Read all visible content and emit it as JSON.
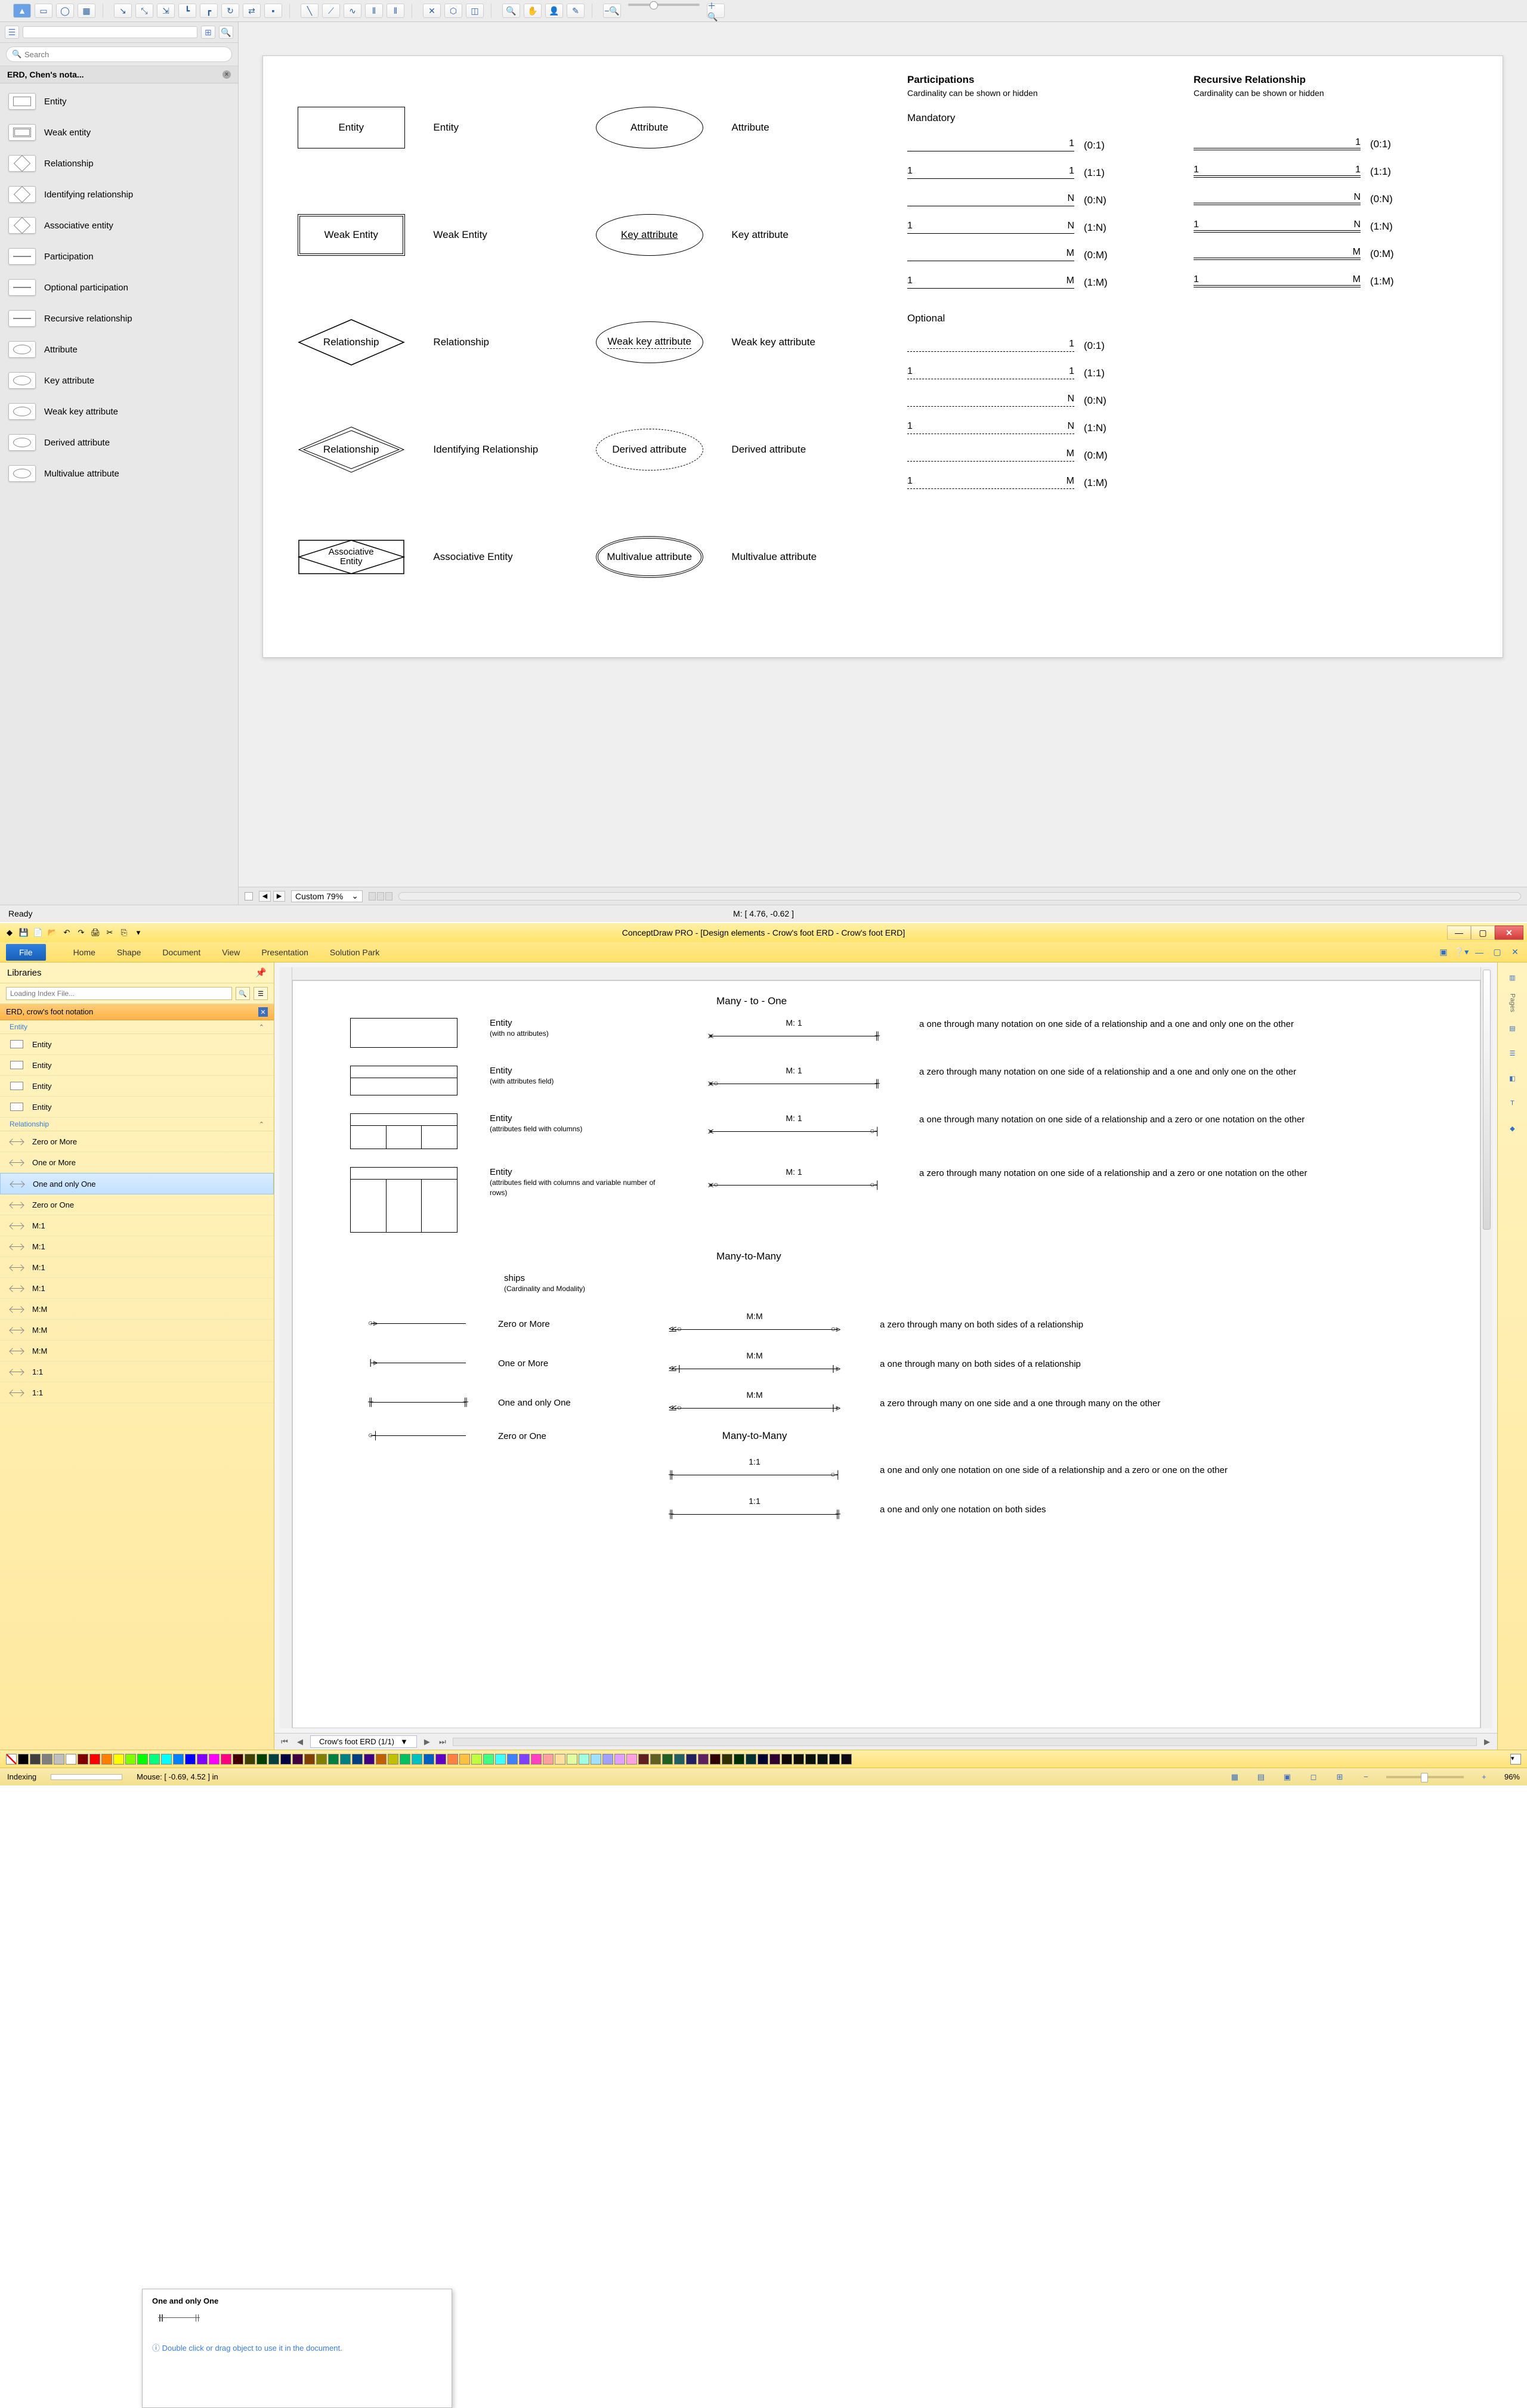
{
  "mac": {
    "search_placeholder": "Search",
    "library": {
      "title": "ERD, Chen's nota...",
      "items": [
        "Entity",
        "Weak entity",
        "Relationship",
        "Identifying relationship",
        "Associative entity",
        "Participation",
        "Optional participation",
        "Recursive relationship",
        "Attribute",
        "Key attribute",
        "Weak key attribute",
        "Derived attribute",
        "Multivalue attribute"
      ]
    },
    "canvas": {
      "participations": {
        "h": "Participations",
        "sub": "Cardinality can be shown or hidden"
      },
      "recursive": {
        "h": "Recursive Relationship",
        "sub": "Cardinality can be shown or hidden"
      },
      "mandatory_h": "Mandatory",
      "optional_h": "Optional",
      "rows": [
        {
          "shape": "Entity",
          "lbl": "Entity",
          "attr": "Attribute",
          "alabel": "Attribute"
        },
        {
          "shape": "Weak Entity",
          "lbl": "Weak Entity",
          "attr": "Key attribute",
          "alabel": "Key attribute",
          "attrUnderline": true
        },
        {
          "shape": "Relationship",
          "lbl": "Relationship",
          "attr": "Weak key attribute",
          "alabel": "Weak key attribute",
          "attrDashUL": true
        },
        {
          "shape": "Relationship",
          "lbl": "Identifying Relationship",
          "attr": "Derived attribute",
          "alabel": "Derived attribute",
          "attrDashed": true
        },
        {
          "shape": "Associative Entity",
          "lbl": "Associative Entity",
          "attr": "Multivalue attribute",
          "alabel": "Multivalue attribute",
          "attrDouble": true
        }
      ],
      "card_mand": [
        {
          "l": "",
          "r": "1",
          "t": "(0:1)"
        },
        {
          "l": "1",
          "r": "1",
          "t": "(1:1)"
        },
        {
          "l": "",
          "r": "N",
          "t": "(0:N)"
        },
        {
          "l": "1",
          "r": "N",
          "t": "(1:N)"
        },
        {
          "l": "",
          "r": "M",
          "t": "(0:M)"
        },
        {
          "l": "1",
          "r": "M",
          "t": "(1:M)"
        }
      ],
      "card_opt": [
        {
          "l": "",
          "r": "1",
          "t": "(0:1)"
        },
        {
          "l": "1",
          "r": "1",
          "t": "(1:1)"
        },
        {
          "l": "",
          "r": "N",
          "t": "(0:N)"
        },
        {
          "l": "1",
          "r": "N",
          "t": "(1:N)"
        },
        {
          "l": "",
          "r": "M",
          "t": "(0:M)"
        },
        {
          "l": "1",
          "r": "M",
          "t": "(1:M)"
        }
      ]
    },
    "zoom": "Custom 79%",
    "status_left": "Ready",
    "status_center": "M: [ 4.76, -0.62 ]"
  },
  "win": {
    "title": "ConceptDraw PRO - [Design elements - Crow's foot ERD - Crow's foot ERD]",
    "menus": [
      "Home",
      "Shape",
      "Document",
      "View",
      "Presentation",
      "Solution Park"
    ],
    "file": "File",
    "sidebar": {
      "h": "Libraries",
      "search_placeholder": "Loading Index File...",
      "lib_h": "ERD, crow's foot notation",
      "cat_entity": "Entity",
      "entity_items": [
        "Entity",
        "Entity",
        "Entity",
        "Entity"
      ],
      "cat_rel": "Relationship",
      "rel_items": [
        "Zero or More",
        "One or More",
        "One and only One",
        "Zero or One",
        "M:1",
        "M:1",
        "M:1",
        "M:1",
        "M:M",
        "M:M",
        "M:M",
        "1:1",
        "1:1"
      ]
    },
    "tooltip": {
      "title": "One and only One",
      "hint": "Double click or drag object to use it in the document."
    },
    "canvas": {
      "sec_m1": "Many - to - One",
      "entities": [
        {
          "h": "Entity",
          "sub": "(with no attributes)"
        },
        {
          "h": "Entity",
          "sub": "(with attributes field)"
        },
        {
          "h": "Entity",
          "sub": "(attributes field with columns)"
        },
        {
          "h": "Entity",
          "sub": "(attributes field with columns and variable number of rows)"
        }
      ],
      "rel_sec_h": "ships",
      "rel_sec_sub": "(Cardinality and Modality)",
      "rel_basic": [
        "Zero or More",
        "One or More",
        "One and only One",
        "Zero or One"
      ],
      "m1": [
        {
          "ratio": "M: 1",
          "desc": "a one through many notation on one side of a relationship and a one and only one on the other"
        },
        {
          "ratio": "M: 1",
          "desc": "a zero through many notation on one side of a relationship and a one and only one on the other"
        },
        {
          "ratio": "M: 1",
          "desc": "a one through many notation on one side of a relationship and a zero or one notation on the other"
        },
        {
          "ratio": "M: 1",
          "desc": "a zero through many notation on one side of a relationship and a zero or one notation on the other"
        }
      ],
      "sec_mm": "Many-to-Many",
      "mm": [
        {
          "ratio": "M:M",
          "desc": "a zero through many on both sides of a relationship"
        },
        {
          "ratio": "M:M",
          "desc": "a one through many on both sides of a relationship"
        },
        {
          "ratio": "M:M",
          "desc": "a zero through many on one side and a one through many on the other"
        }
      ],
      "sec_11": "Many-to-Many",
      "oneone": [
        {
          "ratio": "1:1",
          "desc": "a one and only one notation on one side of a relationship and a zero or one on the other"
        },
        {
          "ratio": "1:1",
          "desc": "a one and only one notation on both sides"
        }
      ]
    },
    "tab": "Crow's foot ERD (1/1)",
    "status_left": "Indexing",
    "status_mouse": "Mouse: [ -0.69, 4.52 ] in",
    "zoom_pct": "96%",
    "rpanel": "Pages"
  },
  "palette": [
    "#000000",
    "#3f3f3f",
    "#7f7f7f",
    "#bfbfbf",
    "#ffffff",
    "#7f0000",
    "#ff0000",
    "#ff7f00",
    "#ffff00",
    "#7fff00",
    "#00ff00",
    "#00ff7f",
    "#00ffff",
    "#007fff",
    "#0000ff",
    "#7f00ff",
    "#ff00ff",
    "#ff007f",
    "#400000",
    "#404000",
    "#004000",
    "#004040",
    "#000040",
    "#400040",
    "#804000",
    "#808000",
    "#008040",
    "#008080",
    "#004080",
    "#400080",
    "#c06000",
    "#c0c000",
    "#00c060",
    "#00c0c0",
    "#0060c0",
    "#6000c0",
    "#ff8040",
    "#ffc040",
    "#c0ff40",
    "#40ff80",
    "#40ffff",
    "#4080ff",
    "#8040ff",
    "#ff40c0",
    "#ffa0a0",
    "#ffe0a0",
    "#e0ffa0",
    "#a0ffe0",
    "#a0e0ff",
    "#a0a0ff",
    "#e0a0ff",
    "#ffa0e0",
    "#602020",
    "#606020",
    "#206020",
    "#206060",
    "#202060",
    "#602060",
    "#300000",
    "#303000",
    "#003000",
    "#003030",
    "#000030",
    "#300030",
    "#100808",
    "#101008",
    "#081008",
    "#081010",
    "#080810",
    "#100810"
  ]
}
